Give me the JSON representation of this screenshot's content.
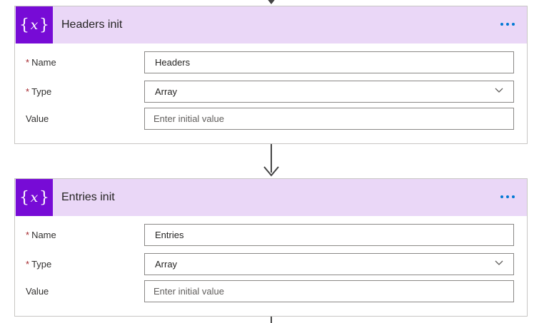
{
  "cards": [
    {
      "title": "Headers init",
      "icon": "variable-icon",
      "fields": {
        "name": {
          "label": "Name",
          "value": "Headers",
          "required": true
        },
        "type": {
          "label": "Type",
          "value": "Array",
          "required": true
        },
        "value": {
          "label": "Value",
          "placeholder": "Enter initial value",
          "required": false
        }
      }
    },
    {
      "title": "Entries init",
      "icon": "variable-icon",
      "fields": {
        "name": {
          "label": "Name",
          "value": "Entries",
          "required": true
        },
        "type": {
          "label": "Type",
          "value": "Array",
          "required": true
        },
        "value": {
          "label": "Value",
          "placeholder": "Enter initial value",
          "required": false
        }
      }
    }
  ],
  "required_marker": "*",
  "colors": {
    "header_bg": "#ead7f7",
    "icon_bg": "#770bd6",
    "accent": "#0078d4",
    "required": "#a4262c"
  }
}
